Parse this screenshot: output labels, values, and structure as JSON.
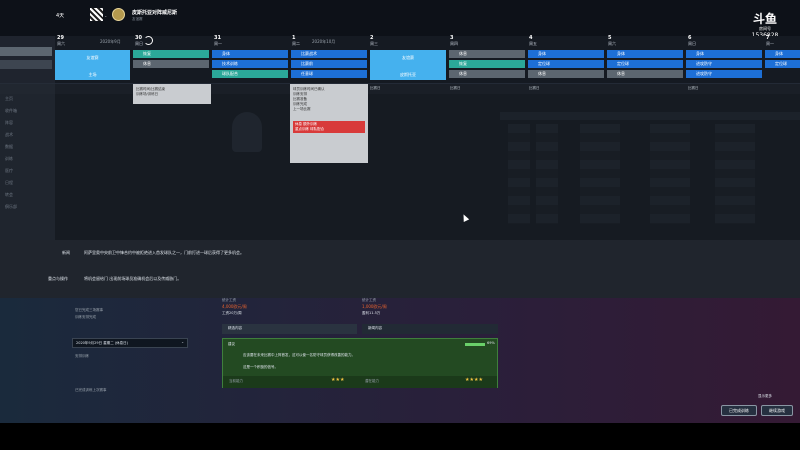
{
  "topbar": {
    "days_left": "4天",
    "club_name": "皮斯托亚对阵威尼斯",
    "subtitle": "友谊赛",
    "date_label": "2020年9月"
  },
  "watermark": {
    "brand": "斗鱼",
    "sub": "房间号",
    "room_id": "1536828"
  },
  "calendar": {
    "days": [
      {
        "num": "29",
        "wd": "周六"
      },
      {
        "num": "30",
        "wd": "周日"
      },
      {
        "num": "31",
        "wd": "周一"
      },
      {
        "num": "1",
        "wd": "周二"
      },
      {
        "num": "2",
        "wd": "周三"
      },
      {
        "num": "3",
        "wd": "周四"
      },
      {
        "num": "4",
        "wd": "周五"
      },
      {
        "num": "5",
        "wd": "周六"
      },
      {
        "num": "6",
        "wd": "周日"
      },
      {
        "num": "7",
        "wd": "周一"
      }
    ],
    "month_mid": "2020年9月",
    "month_right": "2020年10月",
    "big_events": [
      {
        "title": "友谊赛",
        "sub": "主场"
      },
      {
        "title": "友谊赛",
        "sub": "皮斯托亚"
      }
    ],
    "events": [
      {
        "label": "恢复",
        "color": "teal"
      },
      {
        "label": "休息",
        "color": "gray"
      },
      {
        "label": "身体",
        "color": "blue"
      },
      {
        "label": "技术训练",
        "color": "blue"
      },
      {
        "label": "球队配合",
        "color": "teal"
      },
      {
        "label": "比赛战术",
        "color": "blue"
      },
      {
        "label": "比赛前",
        "color": "blue"
      },
      {
        "label": "任意球",
        "color": "blue"
      },
      {
        "label": "恢复",
        "color": "teal"
      },
      {
        "label": "休息",
        "color": "gray"
      },
      {
        "label": "身体",
        "color": "blue"
      },
      {
        "label": "定位球",
        "color": "blue"
      },
      {
        "label": "进攻防守",
        "color": "blue"
      },
      {
        "label": "休息",
        "color": "gray"
      }
    ],
    "strip": [
      "三场比赛后的第一轮训练",
      "新闻发布会",
      "比赛日",
      "比赛日",
      "比赛日",
      "比赛日"
    ]
  },
  "popup": {
    "line1": "比赛时间/比赛结束",
    "line2": "训练场/训练日"
  },
  "popup2": {
    "lines": [
      "球员训练时间已确认",
      "训练安排",
      "比赛准备",
      "训练完成",
      "上一场比赛"
    ],
    "red1": "休息 额外训练",
    "red2": "重点训练 球队配合"
  },
  "sidebar": {
    "items": [
      "主页",
      "收件箱",
      "阵容",
      "战术",
      "数据",
      "训练",
      "医疗",
      "日程",
      "转会",
      "俱乐部"
    ]
  },
  "news": {
    "label1": "新闻",
    "text1": "阿萨里奥中央前卫中锋合约中被拒绝进入首发球队之一，门前打进一球后获得了更多机会。",
    "label2": "重点与操作",
    "text2": "将机会留给门 出现前场球员准确机会后以及传威胁门。"
  },
  "lower": {
    "left_item1": "您已完成三场赛事",
    "left_item2": "训练安排完成",
    "dropdown": "2020年9月29日 星期二 (休息日)",
    "left_item3": "安排训练",
    "left_item4": "已完成训练上次赛事",
    "mid_head1": "统计工资",
    "mid_val1": "4,000欧元/周",
    "mid_sub1": "工资20万/周",
    "mid_head2": "统计工资",
    "mid_val2": "1,000欧元/周",
    "mid_sub2": "盈利11.5万",
    "tab1": "精选内容",
    "tab2": "新闻内容",
    "box_title": "建议",
    "box_text1": "应该要在未来比赛中上阵首发，这可以使一名防守球员获得改善的能力。",
    "box_text2": "这是一个积极的信号。",
    "box_label1": "当前能力",
    "box_label2": "潜在能力",
    "pct": "69%",
    "stars1": "★★★",
    "stars2": "★★★★"
  },
  "buttons": {
    "b1": "已完成训练",
    "b2": "继续游戏",
    "corner": "显示更多"
  }
}
